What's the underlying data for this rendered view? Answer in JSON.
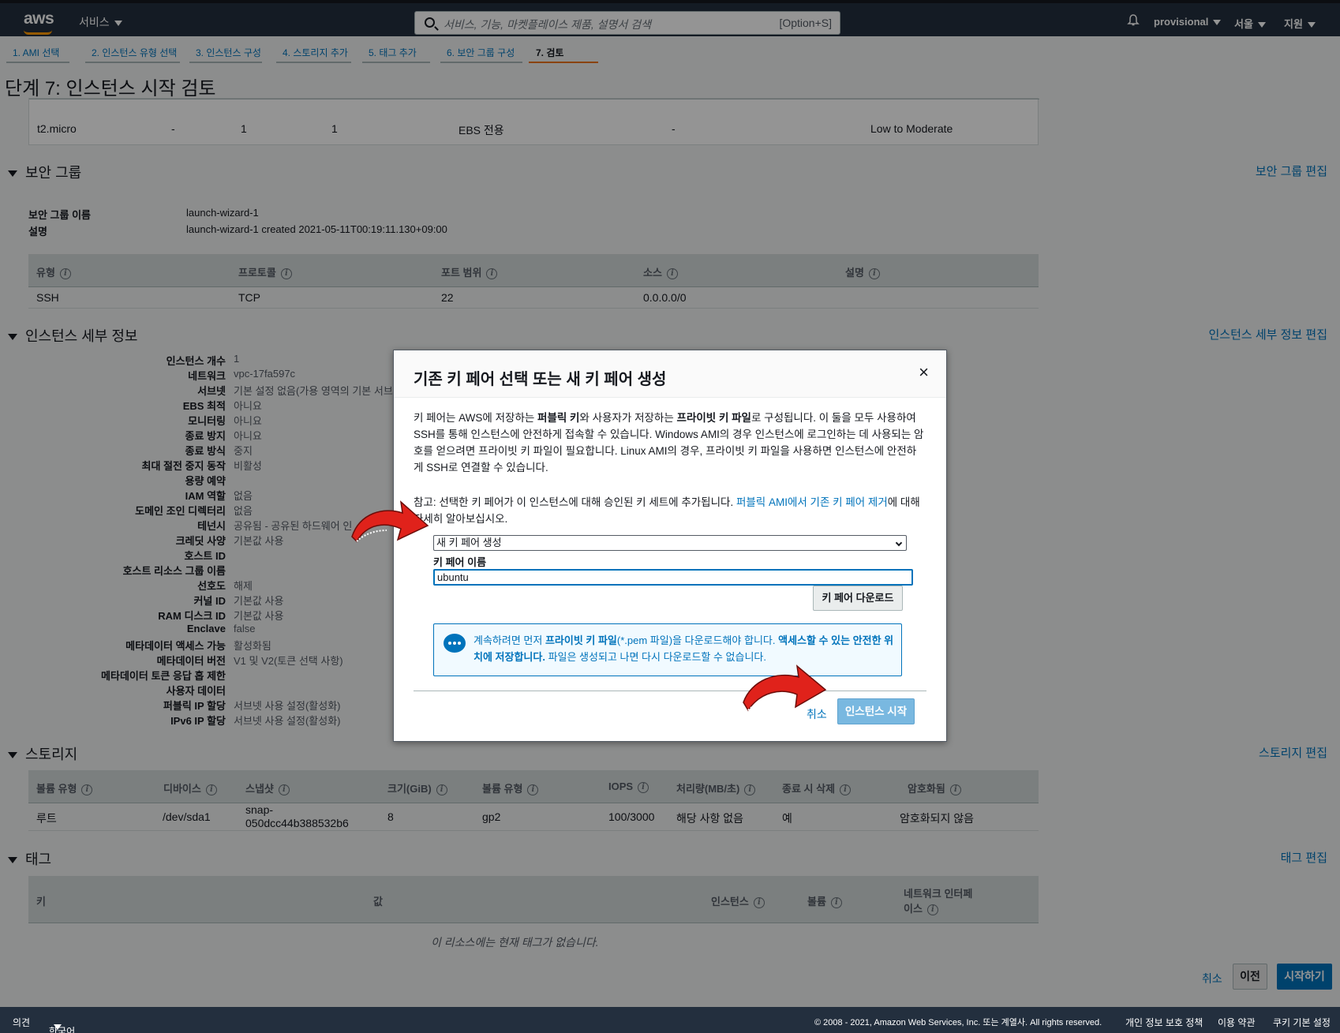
{
  "topbar": {
    "logo": "aws",
    "services": "서비스",
    "search_placeholder": "서비스, 기능, 마켓플레이스 제품, 설명서 검색",
    "search_shortcut": "[Option+S]",
    "account": "provisional",
    "region": "서울",
    "support": "지원"
  },
  "wizard_tabs": [
    "1. AMI 선택",
    "2. 인스턴스 유형 선택",
    "3. 인스턴스 구성",
    "4. 스토리지 추가",
    "5. 태그 추가",
    "6. 보안 그룹 구성",
    "7. 검토"
  ],
  "page_title": "단계 7: 인스턴스 시작 검토",
  "instance_type_table": {
    "row": [
      "t2.micro",
      "-",
      "1",
      "1",
      "EBS 전용",
      "-",
      "Low to Moderate"
    ]
  },
  "security_group": {
    "title": "보안 그룹",
    "edit": "보안 그룹 편집",
    "name_label": "보안 그룹 이름",
    "name_value": "launch-wizard-1",
    "desc_label": "설명",
    "desc_value": "launch-wizard-1 created 2021-05-11T00:19:11.130+09:00",
    "headers": [
      "유형",
      "프로토콜",
      "포트 범위",
      "소스",
      "설명"
    ],
    "row": [
      "SSH",
      "TCP",
      "22",
      "0.0.0.0/0",
      ""
    ]
  },
  "instance_details": {
    "title": "인스턴스 세부 정보",
    "edit": "인스턴스 세부 정보 편집",
    "items": [
      {
        "label": "인스턴스 개수",
        "value": "1"
      },
      {
        "label": "네트워크",
        "value": "vpc-17fa597c"
      },
      {
        "label": "서브넷",
        "value": "기본 설정 없음(가용 영역의 기본 서브넷"
      },
      {
        "label": "EBS 최적",
        "value": "아니요"
      },
      {
        "label": "모니터링",
        "value": "아니요"
      },
      {
        "label": "종료 방지",
        "value": "아니요"
      },
      {
        "label": "종료 방식",
        "value": "중지"
      },
      {
        "label": "최대 절전 중지 동작",
        "value": "비활성"
      },
      {
        "label": "용량 예약",
        "value": ""
      },
      {
        "label": "IAM 역할",
        "value": "없음"
      },
      {
        "label": "도메인 조인 디렉터리",
        "value": "없음"
      },
      {
        "label": "테넌시",
        "value": "공유됨 - 공유된 하드웨어 인"
      },
      {
        "label": "크레딧 사양",
        "value": "기본값 사용"
      },
      {
        "label": "호스트 ID",
        "value": ""
      },
      {
        "label": "호스트 리소스 그룹 이름",
        "value": ""
      },
      {
        "label": "선호도",
        "value": "해제"
      },
      {
        "label": "커널 ID",
        "value": "기본값 사용"
      },
      {
        "label": "RAM 디스크 ID",
        "value": "기본값 사용"
      },
      {
        "label": "Enclave",
        "value": "false"
      },
      {
        "label": "메타데이터 액세스 가능",
        "value": "활성화됨"
      },
      {
        "label": "메타데이터 버전",
        "value": "V1 및 V2(토큰 선택 사항)"
      },
      {
        "label": "메타데이터 토큰 응답 홉 제한",
        "value": ""
      },
      {
        "label": "사용자 데이터",
        "value": ""
      },
      {
        "label": "퍼블릭 IP 할당",
        "value": "서브넷 사용 설정(활성화)"
      },
      {
        "label": "IPv6 IP 할당",
        "value": "서브넷 사용 설정(활성화)"
      }
    ]
  },
  "storage": {
    "title": "스토리지",
    "edit": "스토리지 편집",
    "headers": [
      "볼륨 유형",
      "디바이스",
      "스냅샷",
      "크기(GiB)",
      "볼륨 유형",
      "IOPS",
      "처리량(MB/초)",
      "종료 시 삭제",
      "암호화됨"
    ],
    "row": [
      "루트",
      "/dev/sda1",
      "snap-",
      "050dcc44b388532b6",
      "8",
      "gp2",
      "100/3000",
      "해당 사항 없음",
      "예",
      "암호화되지 않음"
    ]
  },
  "tags": {
    "title": "태그",
    "edit": "태그 편집",
    "headers": [
      "키",
      "값",
      "인스턴스",
      "볼륨",
      "네트워크 인터페",
      "이스"
    ],
    "empty": "이 리소스에는 현재 태그가 없습니다."
  },
  "modal": {
    "title": "기존 키 페어 선택 또는 새 키 페어 생성",
    "close": "×",
    "body_parts": [
      "키 페어는 AWS에 저장하는 ",
      "퍼블릭 키",
      "와 사용자가 저장하는 ",
      "프라이빗 키 파일",
      "로 구성됩니다. 이 둘을 모두 사용하여 SSH를 통해 인스턴스에 안전하게 접속할 수 있습니다. Windows AMI의 경우 인스턴스에 로그인하는 데 사용되는 암호를 얻으려면 프라이빗 키 파일이 필요합니다. Linux AMI의 경우, 프라이빗 키 파일을 사용하면 인스턴스에 안전하게 SSH로 연결할 수 있습니다."
    ],
    "note_prefix": "참고: 선택한 키 페어가 이 인스턴스에 대해 승인된 키 세트에 추가됩니다. ",
    "note_link": "퍼블릭 AMI에서 기존 키 페어 제거",
    "note_suffix": "에 대해 자세히 알아보십시오.",
    "select_value": "새 키 페어 생성",
    "key_name_label": "키 페어 이름",
    "key_name_value": "ubuntu",
    "download_button": "키 페어 다운로드",
    "alert_parts": [
      "계속하려면 먼저 ",
      "프라이빗 키 파일",
      "(*.pem 파일)을 다운로드해야 합니다. ",
      "액세스할 수 있는 안전한 위치에 저장합니다.",
      " 파일은 생성되고 나면 다시 다운로드할 수 없습니다."
    ],
    "cancel": "취소",
    "launch": "인스턴스 시작"
  },
  "bottom_actions": {
    "cancel": "취소",
    "prev": "이전",
    "start": "시작하기"
  },
  "footer": {
    "feedback": "의견",
    "language": "한국어",
    "copyright": "© 2008 - 2021, Amazon Web Services, Inc. 또는 계열사. All rights reserved.",
    "privacy": "개인 정보 보호 정책",
    "terms": "이용 약관",
    "cookies": "쿠키 기본 설정"
  },
  "colors": {
    "nav_bg": "#232f3e",
    "link": "#0073bb",
    "accent": "#ec7211",
    "arrow": "#e0221b"
  }
}
